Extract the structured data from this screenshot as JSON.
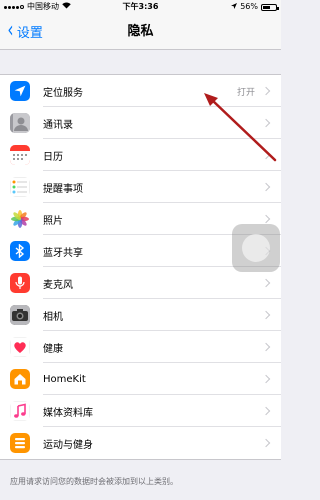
{
  "status_bar": {
    "carrier": "中国移动",
    "time": "下午3:36",
    "battery": "56%",
    "battery_level": 0.56
  },
  "nav": {
    "back_label": "设置",
    "title": "隐私"
  },
  "rows": [
    {
      "label": "定位服务",
      "value": "打开",
      "icon": "location-arrow-icon",
      "color": "#007aff"
    },
    {
      "label": "通讯录",
      "value": "",
      "icon": "contacts-icon",
      "color": "#8e8e93"
    },
    {
      "label": "日历",
      "value": "",
      "icon": "calendar-icon",
      "color": "#ff3b30"
    },
    {
      "label": "提醒事项",
      "value": "",
      "icon": "reminders-icon",
      "color": "#ffffff"
    },
    {
      "label": "照片",
      "value": "",
      "icon": "photos-icon",
      "color": "#ffffff"
    },
    {
      "label": "蓝牙共享",
      "value": "",
      "icon": "bluetooth-icon",
      "color": "#007aff"
    },
    {
      "label": "麦克风",
      "value": "",
      "icon": "microphone-icon",
      "color": "#ff3b30"
    },
    {
      "label": "相机",
      "value": "",
      "icon": "camera-icon",
      "color": "#4a4a4a"
    },
    {
      "label": "健康",
      "value": "",
      "icon": "health-heart-icon",
      "color": "#ffffff"
    },
    {
      "label": "HomeKit",
      "value": "",
      "icon": "homekit-icon",
      "color": "#ff9500"
    },
    {
      "label": "媒体资料库",
      "value": "",
      "icon": "music-note-icon",
      "color": "#ffffff"
    },
    {
      "label": "运动与健身",
      "value": "",
      "icon": "motion-fitness-icon",
      "color": "#ff9500"
    }
  ],
  "footer": "应用请求访问您的数据时会被添加到以上类别。",
  "accent": "#007aff",
  "annotation_color": "#b01c1c"
}
